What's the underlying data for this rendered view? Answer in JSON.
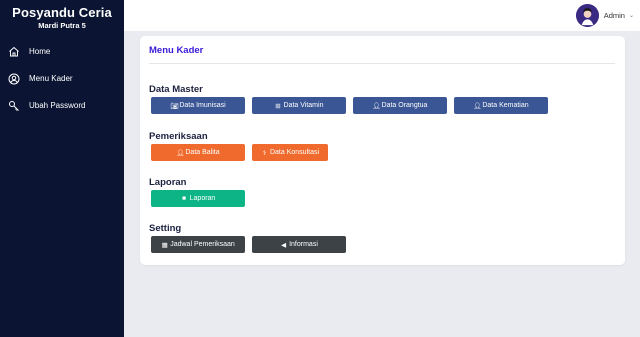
{
  "sidebar": {
    "brand_title": "Posyandu Ceria",
    "brand_subtitle": "Mardi Putra 5",
    "items": [
      {
        "label": "Home",
        "icon": "home-icon"
      },
      {
        "label": "Menu Kader",
        "icon": "user-circle-icon"
      },
      {
        "label": "Ubah Password",
        "icon": "key-icon"
      }
    ]
  },
  "topbar": {
    "user_name": "Admin",
    "caret": "⌄"
  },
  "card": {
    "title": "Menu Kader",
    "sections": {
      "data_master": {
        "title": "Data Master",
        "buttons": [
          {
            "label": "Data Imunisasi",
            "icon": "camera-icon"
          },
          {
            "label": "Data Vitamin",
            "icon": "plus-square-icon"
          },
          {
            "label": "Data Orangtua",
            "icon": "user-plus-icon"
          },
          {
            "label": "Data Kematian",
            "icon": "user-minus-icon"
          }
        ]
      },
      "pemeriksaan": {
        "title": "Pemeriksaan",
        "buttons": [
          {
            "label": "Data Balita",
            "icon": "user-icon"
          },
          {
            "label": "Data Konsultasi",
            "icon": "stethoscope-icon"
          }
        ]
      },
      "laporan": {
        "title": "Laporan",
        "buttons": [
          {
            "label": "Laporan",
            "icon": "book-icon"
          }
        ]
      },
      "setting": {
        "title": "Setting",
        "buttons": [
          {
            "label": "Jadwal Pemeriksaan",
            "icon": "calendar-icon"
          },
          {
            "label": "Informasi",
            "icon": "megaphone-icon"
          }
        ]
      }
    }
  },
  "colors": {
    "sidebar_bg": "#0b1533",
    "accent_title": "#3a1ad9",
    "btn_blue": "#3a5694",
    "btn_orange": "#ef6a2c",
    "btn_green": "#0cb486",
    "btn_dark": "#3d4246"
  }
}
